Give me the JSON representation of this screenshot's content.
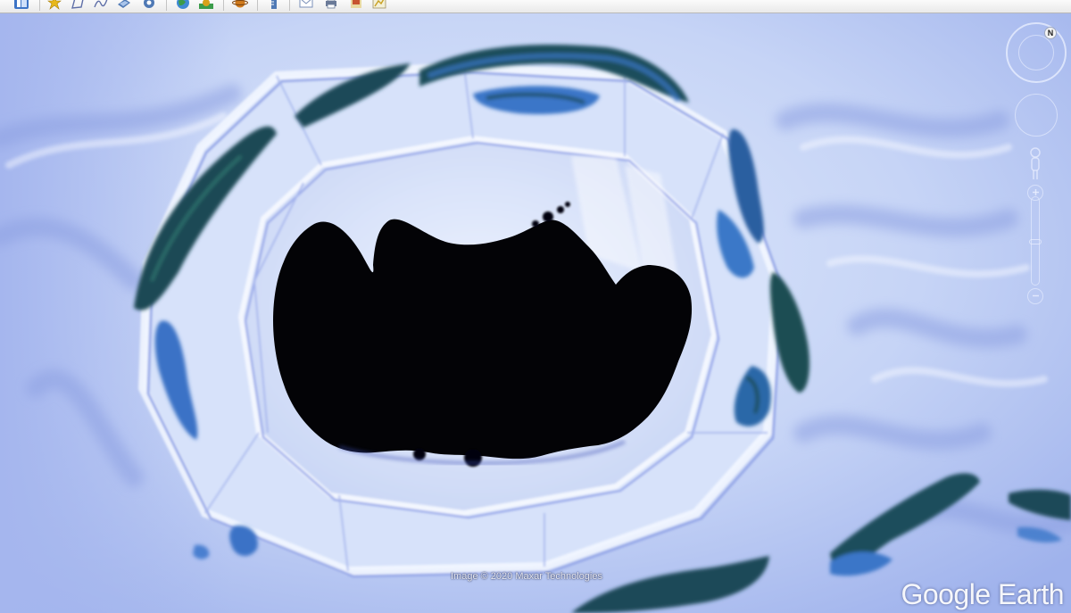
{
  "toolbar": {
    "buttons": [
      {
        "id": "sidebar",
        "icon": "sidebar-toggle-icon",
        "color": "#3d74c6"
      },
      {
        "id": "placemark",
        "icon": "placemark-pin-icon",
        "color": "#e8b81a"
      },
      {
        "id": "polygon",
        "icon": "polygon-icon",
        "color": "#5f6fa8"
      },
      {
        "id": "path",
        "icon": "path-icon",
        "color": "#5f6fa8"
      },
      {
        "id": "image-overlay",
        "icon": "image-overlay-icon",
        "color": "#4f79b5"
      },
      {
        "id": "tour",
        "icon": "record-tour-icon",
        "color": "#4f79b5"
      },
      {
        "id": "historical",
        "icon": "historical-imagery-icon",
        "color": "#3b9c4a"
      },
      {
        "id": "sunlight",
        "icon": "sunlight-icon",
        "color": "#d7a21b"
      },
      {
        "id": "planets",
        "icon": "planets-icon",
        "color": "#d17a1c"
      },
      {
        "id": "ruler",
        "icon": "ruler-icon",
        "color": "#4f79b5"
      },
      {
        "id": "email",
        "icon": "email-icon",
        "color": "#7a8fb8"
      },
      {
        "id": "print",
        "icon": "print-icon",
        "color": "#6a7a98"
      },
      {
        "id": "save-image",
        "icon": "save-image-icon",
        "color": "#c7542f"
      },
      {
        "id": "view-maps",
        "icon": "view-in-maps-icon",
        "color": "#c9a020"
      }
    ]
  },
  "map": {
    "attribution": "Image © 2020 Maxar Technologies",
    "brand": "Google Earth",
    "palette": {
      "snow_light": "#dfe9fb",
      "snow_mid": "#b9caf2",
      "snow_shadow": "#8ea2e6",
      "water_deep": "#1c4a5c",
      "water_shallow": "#3a76c8",
      "lake": "#030306"
    }
  },
  "navigation": {
    "north_label": "N"
  }
}
